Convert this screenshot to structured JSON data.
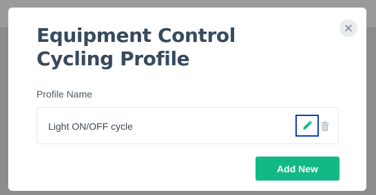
{
  "modal": {
    "title": "Equipment Control Cycling Profile",
    "close_icon": "close-icon"
  },
  "profile_form": {
    "label": "Profile Name",
    "profiles": [
      {
        "name": "Light ON/OFF cycle",
        "edit_icon": "pencil-icon",
        "delete_icon": "trash-icon"
      }
    ]
  },
  "actions": {
    "add_label": "Add New"
  },
  "colors": {
    "title": "#384a5e",
    "primary_button": "#12b886",
    "edit_icon": "#12b886",
    "focus_outline": "#0b3fb0",
    "delete_icon": "#b6bdc5"
  }
}
